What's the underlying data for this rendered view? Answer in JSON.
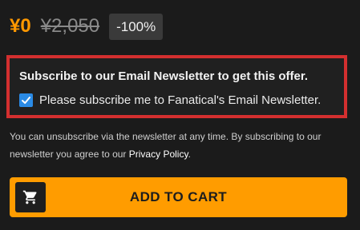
{
  "price": {
    "current": "¥0",
    "original": "¥2,050",
    "discount": "-100%"
  },
  "offer": {
    "title": "Subscribe to our Email Newsletter to get this offer.",
    "checkbox_label": "Please subscribe me to Fanatical's Email Newsletter.",
    "checked": true
  },
  "info": {
    "text": "You can unsubscribe via the newsletter at any time. By subscribing to our newsletter you agree to our ",
    "link_text": "Privacy Policy",
    "suffix": "."
  },
  "cart_button": {
    "label": "ADD TO CART",
    "icon": "shopping-cart-icon"
  },
  "colors": {
    "accent_orange": "#ff9c00",
    "highlight_red": "#d32f2f",
    "checkbox_blue": "#2a8be6",
    "background": "#1b1b1b"
  }
}
